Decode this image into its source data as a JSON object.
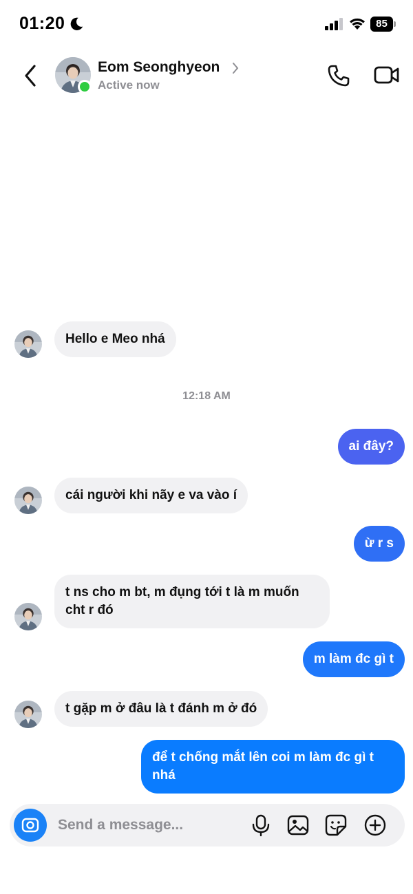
{
  "status_bar": {
    "time": "01:20",
    "battery": "85"
  },
  "header": {
    "contact_name": "Eom Seonghyeon",
    "status": "Active now"
  },
  "messages": [
    {
      "side": "in",
      "text": "Hello e Meo nhá"
    },
    {
      "side": "timestamp",
      "text": "12:18 AM"
    },
    {
      "side": "out",
      "text": "ai đây?"
    },
    {
      "side": "in",
      "text": "cái người khi nãy e va vào í"
    },
    {
      "side": "out",
      "text": "ừ r s"
    },
    {
      "side": "in",
      "text": "t ns cho m bt, m đụng tới t là m muốn cht r đó"
    },
    {
      "side": "out",
      "text": "m làm đc gì t"
    },
    {
      "side": "in",
      "text": "t gặp m ở đâu là t đánh m ở đó"
    },
    {
      "side": "out",
      "text": "để t chống mắt lên coi m làm đc gì t nhá"
    }
  ],
  "composer": {
    "placeholder": "Send a message..."
  },
  "colors": {
    "accent": "#1a82f7",
    "bubble_out_top": "#4b63f0",
    "bubble_out_bottom": "#0a7cff",
    "bubble_in": "#f1f1f3",
    "online": "#2ecc40"
  }
}
